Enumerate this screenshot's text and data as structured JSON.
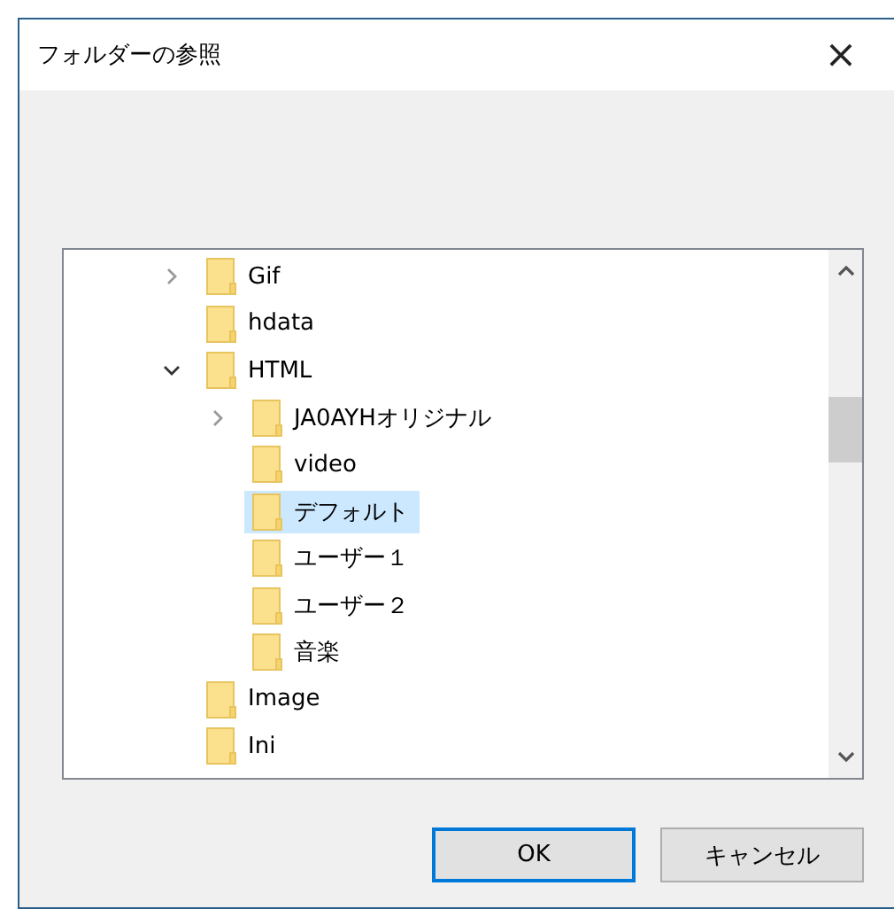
{
  "window": {
    "title": "フォルダーの参照",
    "close": "×"
  },
  "tree": {
    "items": [
      {
        "label": "Gif",
        "expandable": true,
        "expanded": false,
        "selected": false
      },
      {
        "label": "hdata",
        "expandable": false,
        "selected": false
      },
      {
        "label": "HTML",
        "expandable": true,
        "expanded": true,
        "selected": false,
        "children": [
          {
            "label": "JA0AYHオリジナル",
            "expandable": true,
            "expanded": false,
            "selected": false
          },
          {
            "label": "video",
            "expandable": false,
            "selected": false
          },
          {
            "label": "デフォルト",
            "expandable": false,
            "selected": true
          },
          {
            "label": "ユーザー１",
            "expandable": false,
            "selected": false
          },
          {
            "label": "ユーザー２",
            "expandable": false,
            "selected": false
          },
          {
            "label": "音楽",
            "expandable": false,
            "selected": false
          }
        ]
      },
      {
        "label": "Image",
        "expandable": false,
        "selected": false
      },
      {
        "label": "Ini",
        "expandable": false,
        "selected": false
      }
    ]
  },
  "buttons": [
    {
      "label": "OK",
      "default": true
    },
    {
      "label": "キャンセル",
      "default": false
    }
  ]
}
